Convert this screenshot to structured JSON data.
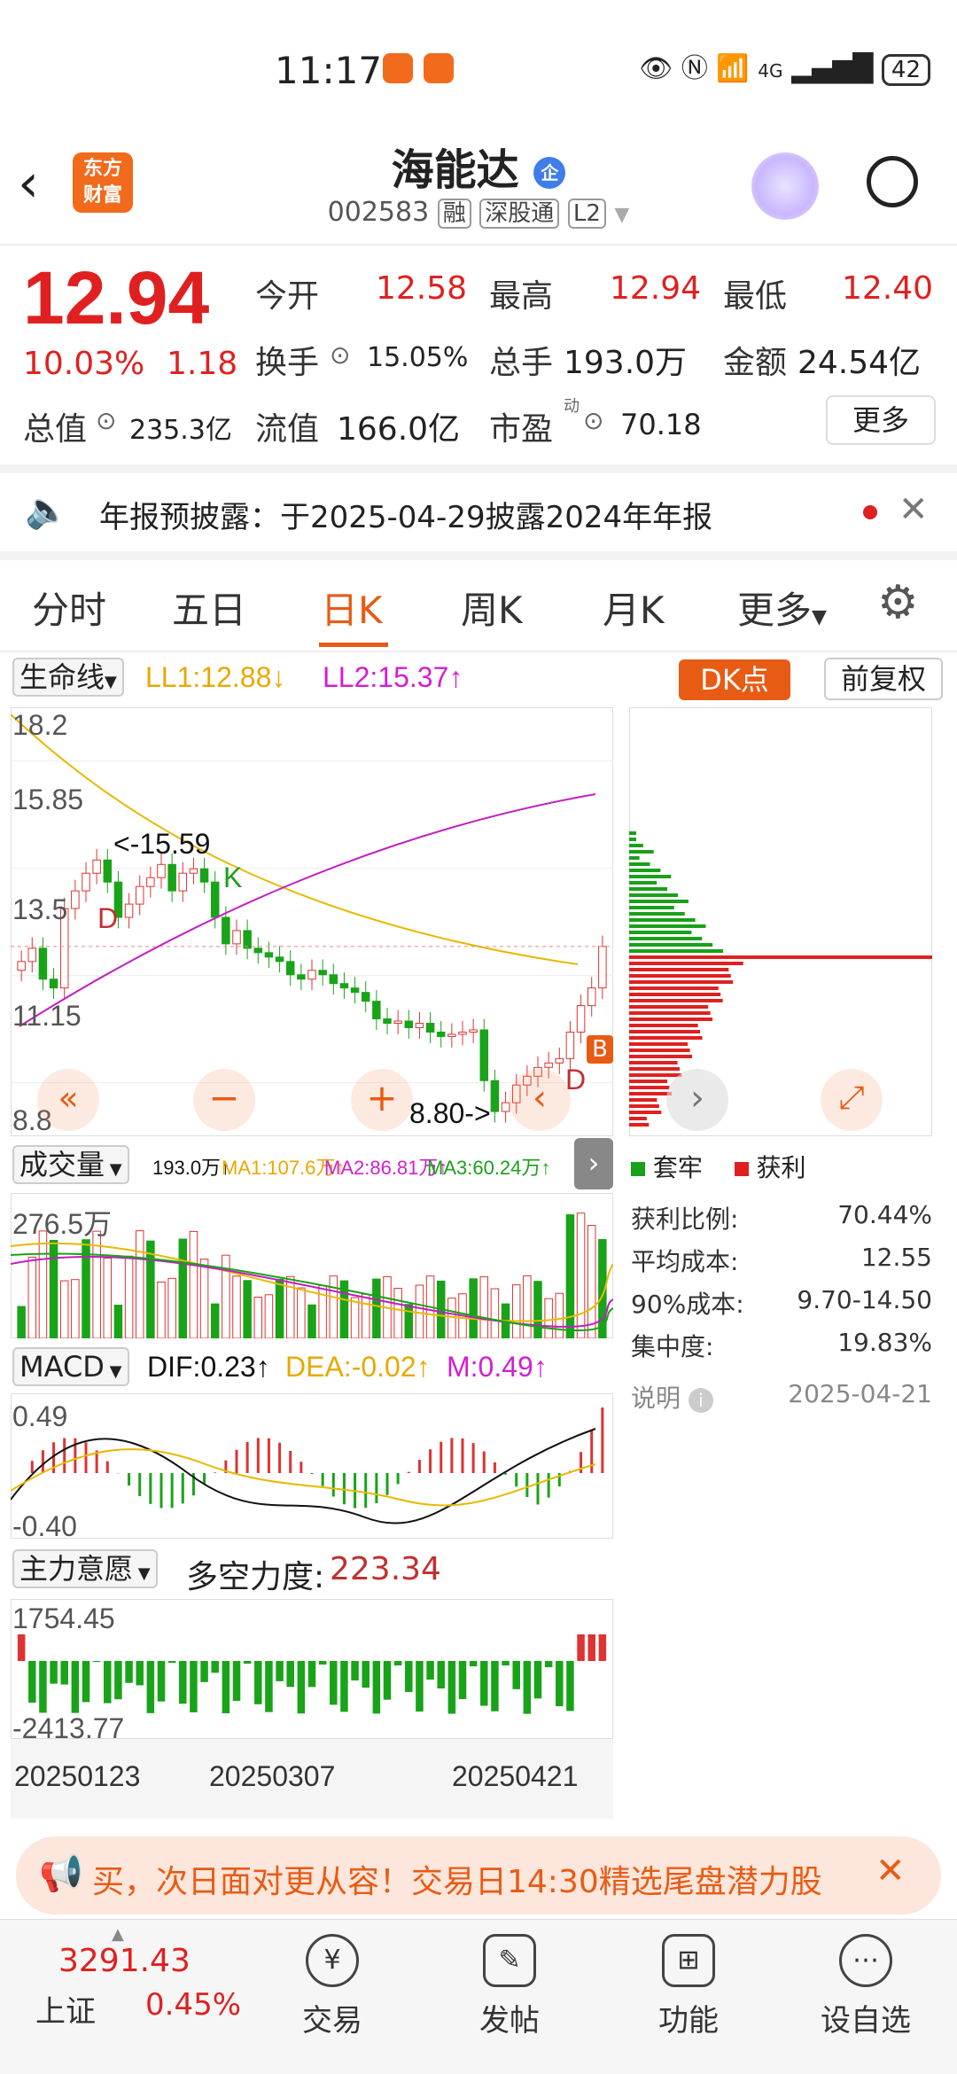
{
  "status_bar": {
    "time": "11:17",
    "battery": "42",
    "network": "4G"
  },
  "header": {
    "stock_name": "海能达",
    "enterprise_badge": "企",
    "stock_code": "002583",
    "tags": [
      "融",
      "深股通",
      "L2"
    ],
    "logo_text": "东方财富"
  },
  "quote": {
    "price": "12.94",
    "change_pct": "10.03%",
    "change": "1.18",
    "open_label": "今开",
    "open": "12.58",
    "high_label": "最高",
    "high": "12.94",
    "low_label": "最低",
    "low": "12.40",
    "turnover_label": "换手",
    "turnover": "15.05%",
    "volume_label": "总手",
    "volume": "193.0万",
    "amount_label": "金额",
    "amount": "24.54亿",
    "mktcap_label": "总值",
    "mktcap": "235.3亿",
    "float_label": "流值",
    "float": "166.0亿",
    "pe_label": "市盈",
    "pe_sup": "动",
    "pe": "70.18",
    "more_button": "更多"
  },
  "notice": {
    "text": "年报预披露：于2025-04-29披露2024年年报"
  },
  "tabs": [
    "分时",
    "五日",
    "日K",
    "周K",
    "月K",
    "更多"
  ],
  "active_tab": "日K",
  "chart_toolbar": {
    "indicator": "生命线",
    "ll1": "LL1:12.88↓",
    "ll2": "LL2:15.37↑",
    "dk_button": "DK点",
    "adjust_button": "前复权"
  },
  "volume_panel": {
    "name": "成交量",
    "vol": "193.0万↑",
    "ma1": "MA1:107.6万↑",
    "ma2": "MA2:86.81万↑",
    "ma3": "MA3:60.24万↑",
    "axis_top": "276.5万"
  },
  "macd_panel": {
    "name": "MACD",
    "dif": "DIF:0.23↑",
    "dea": "DEA:-0.02↑",
    "m": "M:0.49↑",
    "axis_top": "0.49",
    "axis_bottom": "-0.40"
  },
  "main_force_panel": {
    "name": "主力意愿",
    "label": "多空力度:",
    "value": "223.34",
    "axis_top": "1754.45",
    "axis_bottom": "-2413.77"
  },
  "dates": [
    "20250123",
    "20250307",
    "20250421"
  ],
  "chip_panel": {
    "legend_trapped": "套牢",
    "legend_profit": "获利",
    "profit_ratio_label": "获利比例:",
    "profit_ratio": "70.44%",
    "avg_cost_label": "平均成本:",
    "avg_cost": "12.55",
    "cost90_label": "90%成本:",
    "cost90": "9.70-14.50",
    "concentration_label": "集中度:",
    "concentration": "19.83%",
    "note_label": "说明",
    "date": "2025-04-21"
  },
  "chart_data": {
    "type": "line",
    "x": [
      "20250123",
      "20250307",
      "20250421"
    ],
    "y_ticks": [
      18.2,
      15.85,
      13.5,
      11.15,
      8.8
    ],
    "annotations": [
      "<-15.59",
      "8.80->",
      "K",
      "D",
      "D",
      "B"
    ],
    "current_price": 12.94
  },
  "banner": {
    "text": "买，次日面对更从容！交易日14:30精选尾盘潜力股"
  },
  "index": {
    "name": "上证",
    "value": "3291.43",
    "change": "0.45%"
  },
  "nav": [
    "交易",
    "发帖",
    "功能",
    "设自选"
  ]
}
